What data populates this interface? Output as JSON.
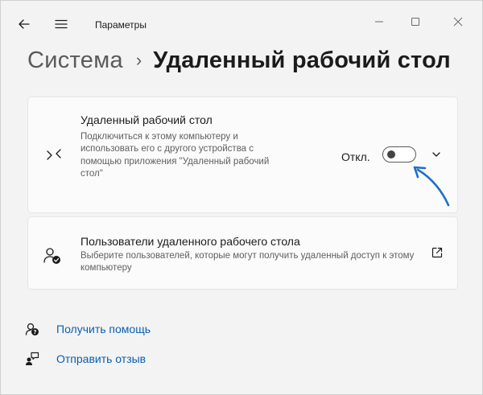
{
  "window": {
    "title": "Параметры"
  },
  "breadcrumb": {
    "parent": "Система",
    "separator": "›",
    "current": "Удаленный рабочий стол"
  },
  "remote_desktop": {
    "title": "Удаленный рабочий стол",
    "description": "Подключиться к этому компьютеру и использовать его с другого устройства с помощью приложения \"Удаленный рабочий стол\"",
    "toggle_label": "Откл.",
    "toggle_on": false
  },
  "remote_users": {
    "title": "Пользователи удаленного рабочего стола",
    "description": "Выберите пользователей, которые могут получить удаленный доступ к этому компьютеру"
  },
  "links": {
    "help": "Получить помощь",
    "feedback": "Отправить отзыв"
  },
  "icons": {
    "back": "arrow-left-icon",
    "menu": "hamburger-menu-icon",
    "remote_desktop": "remote-desktop-icon",
    "users": "user-shield-icon",
    "open_external": "open-external-icon",
    "help": "help-person-icon",
    "feedback": "feedback-icon"
  },
  "colors": {
    "link": "#0a5fb4",
    "annotation_arrow": "#1e6fc9",
    "background": "#f3f3f3",
    "card": "#fbfbfb"
  }
}
